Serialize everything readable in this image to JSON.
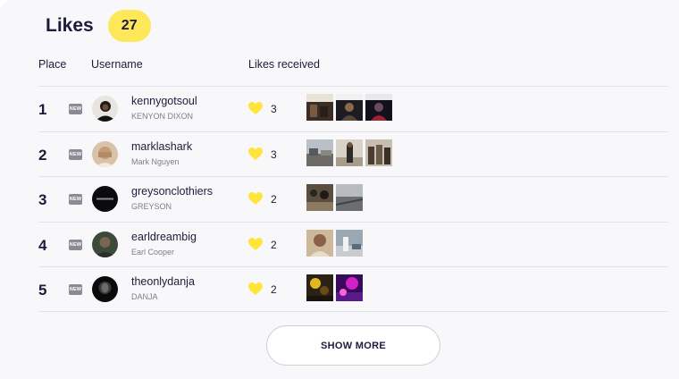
{
  "header": {
    "title": "Likes",
    "badge_count": "27"
  },
  "columns": {
    "place": "Place",
    "username": "Username",
    "likes": "Likes received"
  },
  "new_tag": "NEW",
  "colors": {
    "accent": "#ffe75a",
    "heart": "#ffe53b",
    "tag": "#8b8b96"
  },
  "rows": [
    {
      "place": "1",
      "username": "kennygotsoul",
      "fullname": "KENYON DIXON",
      "likes": "3",
      "avatar": "portrait-dark",
      "thumbs": [
        "photo-group",
        "photo-dark-person",
        "photo-night-person"
      ]
    },
    {
      "place": "2",
      "username": "marklashark",
      "fullname": "Mark Nguyen",
      "likes": "3",
      "avatar": "portrait-face-hands",
      "thumbs": [
        "photo-street",
        "photo-outdoor-person",
        "photo-people-standing"
      ]
    },
    {
      "place": "3",
      "username": "greysonclothiers",
      "fullname": "GREYSON",
      "likes": "2",
      "avatar": "logo-greyson",
      "thumbs": [
        "photo-crowd",
        "photo-road"
      ]
    },
    {
      "place": "4",
      "username": "earldreambig",
      "fullname": "Earl Cooper",
      "likes": "2",
      "avatar": "portrait-man-green",
      "thumbs": [
        "photo-person-close",
        "photo-cars"
      ]
    },
    {
      "place": "5",
      "username": "theonlydanja",
      "fullname": "DANJA",
      "likes": "2",
      "avatar": "portrait-bw-face",
      "thumbs": [
        "photo-yellow-light",
        "photo-purple-light"
      ]
    }
  ],
  "show_more": "SHOW MORE"
}
